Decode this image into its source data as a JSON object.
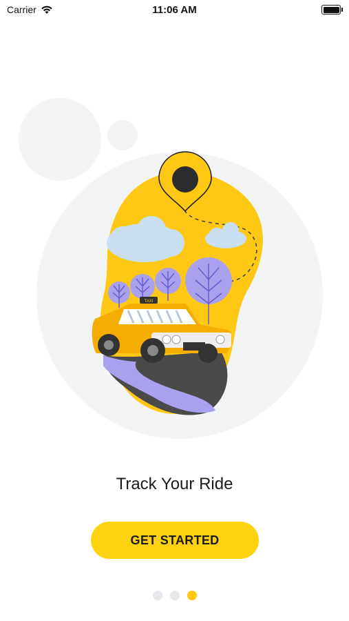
{
  "status_bar": {
    "carrier": "Carrier",
    "time": "11:06 AM"
  },
  "onboarding": {
    "title": "Track Your Ride",
    "cta_label": "GET STARTED",
    "page_indicator": {
      "total": 3,
      "current": 3
    }
  },
  "colors": {
    "accent": "#ffd20f",
    "background": "#ffffff",
    "circle": "#f3f4f6"
  }
}
